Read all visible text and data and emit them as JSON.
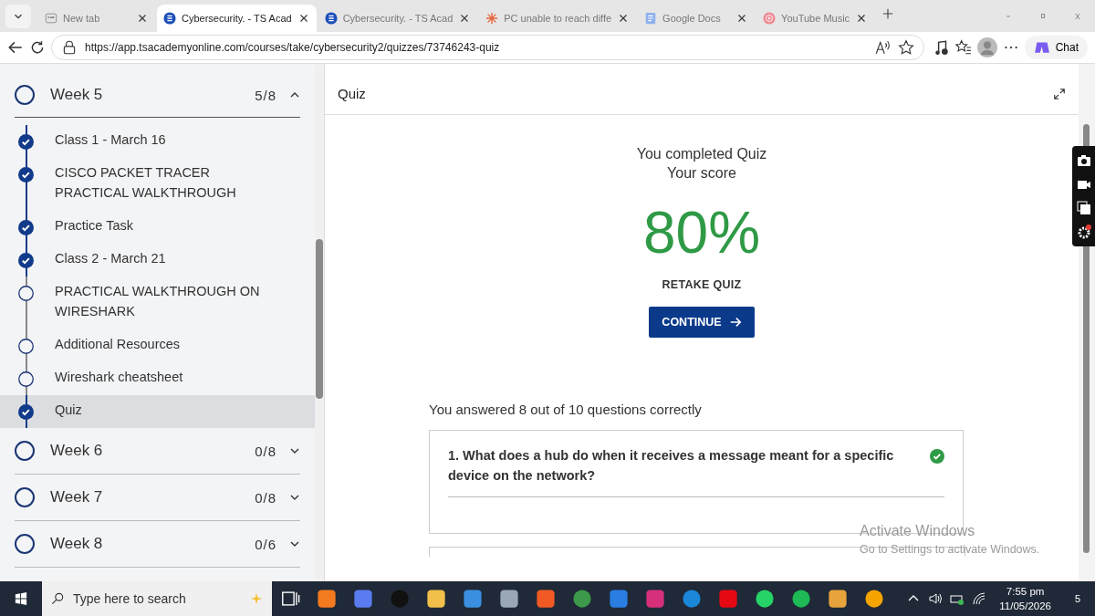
{
  "browser": {
    "tabs": [
      {
        "title": "New tab",
        "selected": false
      },
      {
        "title": "Cybersecurity. - TS Acad",
        "selected": true
      },
      {
        "title": "Cybersecurity. - TS Acad",
        "selected": false
      },
      {
        "title": "PC unable to reach diffe",
        "selected": false
      },
      {
        "title": "Google Docs",
        "selected": false
      },
      {
        "title": "YouTube Music",
        "selected": false
      }
    ],
    "url": "https://app.tsacademyonline.com/courses/take/cybersecurity2/quizzes/73746243-quiz",
    "chat": "Chat"
  },
  "sidebar": {
    "weeks": [
      {
        "title": "Week 5",
        "progress": "5/8",
        "expanded": true,
        "lessons": [
          {
            "title": "Class 1 - March 16",
            "done": true,
            "selected": false
          },
          {
            "title": "CISCO PACKET TRACER PRACTICAL WALKTHROUGH",
            "done": true,
            "selected": false
          },
          {
            "title": "Practice Task",
            "done": true,
            "selected": false
          },
          {
            "title": "Class 2 - March 21",
            "done": true,
            "selected": false
          },
          {
            "title": "PRACTICAL WALKTHROUGH ON WIRESHARK",
            "done": false,
            "selected": false
          },
          {
            "title": "Additional Resources",
            "done": false,
            "selected": false
          },
          {
            "title": "Wireshark cheatsheet",
            "done": false,
            "selected": false
          },
          {
            "title": "Quiz",
            "done": true,
            "selected": true
          }
        ]
      },
      {
        "title": "Week 6",
        "progress": "0/8",
        "expanded": false
      },
      {
        "title": "Week 7",
        "progress": "0/8",
        "expanded": false
      },
      {
        "title": "Week 8",
        "progress": "0/6",
        "expanded": false
      }
    ]
  },
  "quiz": {
    "title": "Quiz",
    "heading": [
      "You completed Quiz",
      "Your score"
    ],
    "score": "80%",
    "retake": "RETAKE QUIZ",
    "continue": "CONTINUE",
    "summary": "You answered 8 out of 10 questions correctly",
    "questions": [
      {
        "text": "1. What does a hub do when it receives a message meant for a specific device on the network?",
        "correct": true
      }
    ]
  },
  "activation": {
    "title": "Activate Windows",
    "subtitle": "Go to Settings to activate Windows."
  },
  "taskbar": {
    "search_placeholder": "Type here to search",
    "time": "7:55 pm",
    "date": "11/05/2026",
    "notifications": "5"
  }
}
